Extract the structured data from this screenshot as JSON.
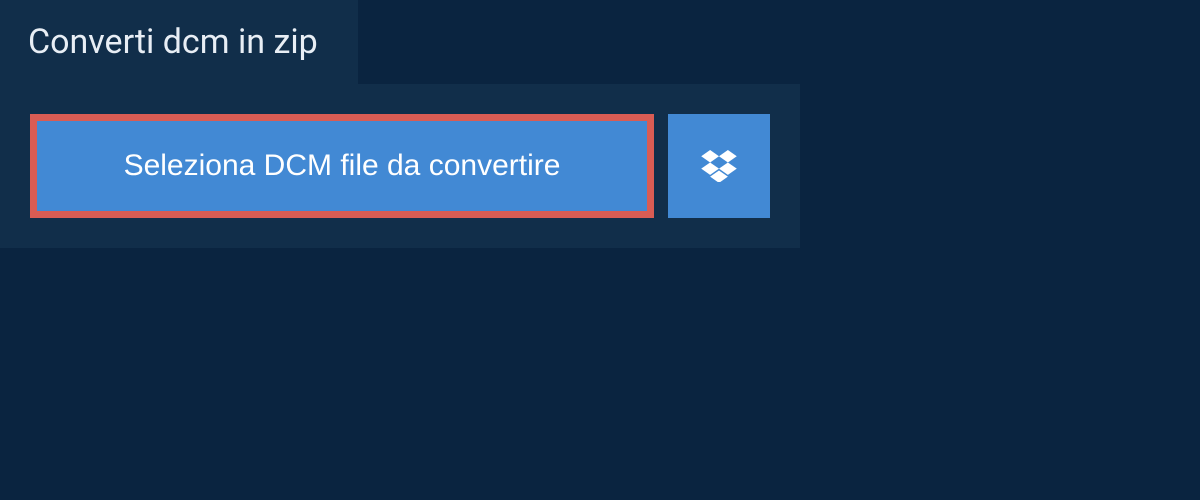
{
  "tab": {
    "title": "Converti dcm in zip"
  },
  "actions": {
    "select_file_label": "Seleziona DCM file da convertire"
  },
  "colors": {
    "highlight_border": "#d95c54",
    "button_bg": "#4289d4",
    "panel_bg": "#112e4a",
    "page_bg": "#0a2440"
  }
}
